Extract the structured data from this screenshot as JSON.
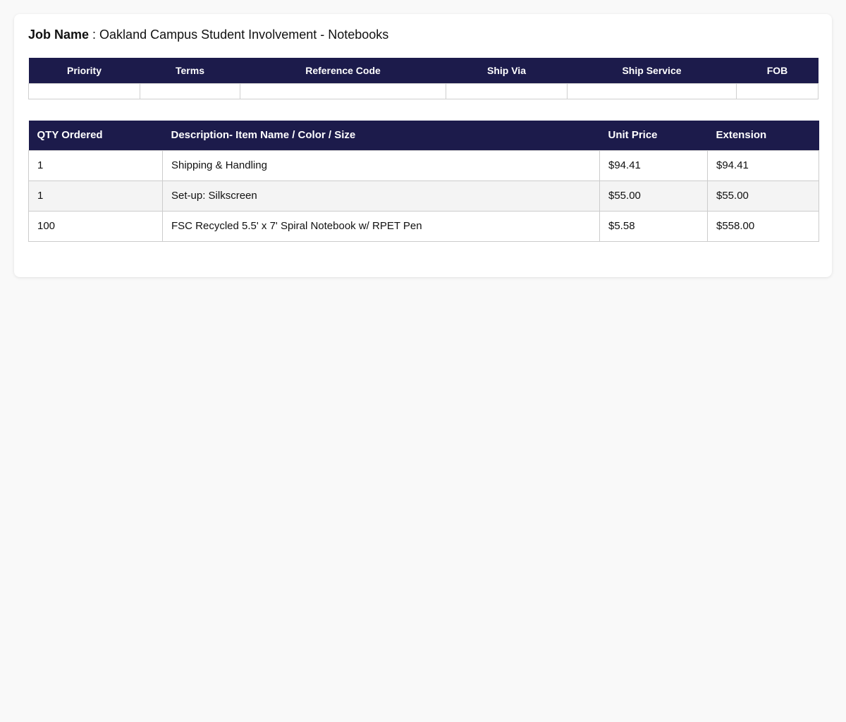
{
  "job": {
    "label": "Job Name",
    "separator": " : ",
    "value": "Oakland Campus Student Involvement - Notebooks"
  },
  "meta_table": {
    "headers": [
      "Priority",
      "Terms",
      "Reference Code",
      "Ship Via",
      "Ship Service",
      "FOB"
    ],
    "values": [
      "",
      "",
      "",
      "",
      "",
      ""
    ]
  },
  "items_table": {
    "headers": [
      "QTY Ordered",
      "Description- Item Name / Color / Size",
      "Unit Price",
      "Extension"
    ],
    "rows": [
      {
        "qty": "1",
        "description": "Shipping & Handling",
        "unit_price": "$94.41",
        "extension": "$94.41"
      },
      {
        "qty": "1",
        "description": "Set-up: Silkscreen",
        "unit_price": "$55.00",
        "extension": "$55.00"
      },
      {
        "qty": "100",
        "description": "FSC Recycled 5.5' x 7' Spiral Notebook w/ RPET Pen",
        "unit_price": "$5.58",
        "extension": "$558.00"
      }
    ]
  },
  "colors": {
    "header_bg": "#1c1b4b",
    "header_text": "#ffffff",
    "page_bg": "#f9f9f9",
    "alt_row_bg": "#f4f4f4"
  }
}
